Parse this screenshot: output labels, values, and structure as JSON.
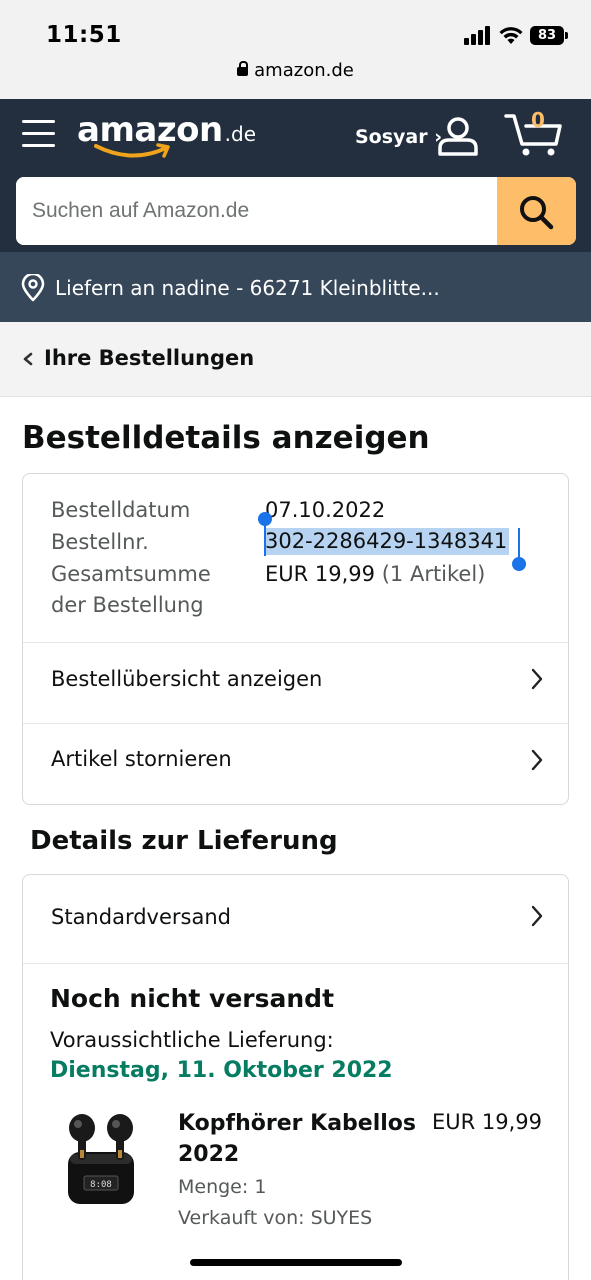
{
  "status_bar": {
    "time": "11:51",
    "battery": "83",
    "url": "amazon.de"
  },
  "header": {
    "logo_main": "amazon",
    "logo_tld": ".de",
    "account_label": "Sosyar ›",
    "cart_count": "0",
    "search_placeholder": "Suchen auf Amazon.de",
    "deliver_to": "Liefern an nadine - 66271 Kleinblitte..."
  },
  "breadcrumb": {
    "label": "Ihre Bestellungen"
  },
  "page": {
    "title": "Bestelldetails anzeigen"
  },
  "order_summary": {
    "date_label": "Bestelldatum",
    "date_value": "07.10.2022",
    "number_label": "Bestellnr.",
    "number_value": "302-2286429-1348341",
    "total_label_1": "Gesamtsumme",
    "total_label_2": "der Bestellung",
    "total_value": "EUR 19,99",
    "total_count": "(1 Artikel)",
    "links": [
      "Bestellübersicht anzeigen",
      "Artikel stornieren"
    ]
  },
  "delivery": {
    "section_title": "Details zur Lieferung",
    "shipping_method": "Standardversand",
    "status": "Noch nicht versandt",
    "eta_label": "Voraussichtliche Lieferung:",
    "eta_date": "Dienstag, 11. Oktober 2022",
    "item": {
      "name": "Kopfhörer Kabellos 2022",
      "price": "EUR 19,99",
      "quantity": "Menge: 1",
      "seller": "Verkauft von: SUYES"
    }
  },
  "colors": {
    "header_bg": "#232f3e",
    "deliver_bar_bg": "#37475a",
    "search_button": "#febd69",
    "eta_green": "#067d62",
    "selection_blue": "#1a73e8"
  }
}
